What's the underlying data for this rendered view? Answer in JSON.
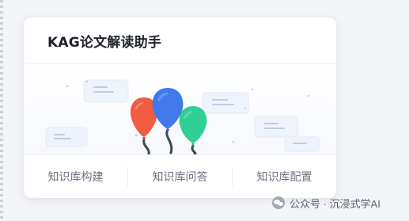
{
  "card": {
    "title": "KAG论文解读助手"
  },
  "footer": {
    "items": [
      {
        "label": "知识库构建"
      },
      {
        "label": "知识库问答"
      },
      {
        "label": "知识库配置"
      }
    ]
  },
  "watermark": {
    "text": "公众号 · 沉浸式学AI"
  },
  "illustration": {
    "balloon_colors": [
      "#f15b3f",
      "#3f79ea",
      "#2fcf96"
    ],
    "string_color": "#3f4654"
  }
}
